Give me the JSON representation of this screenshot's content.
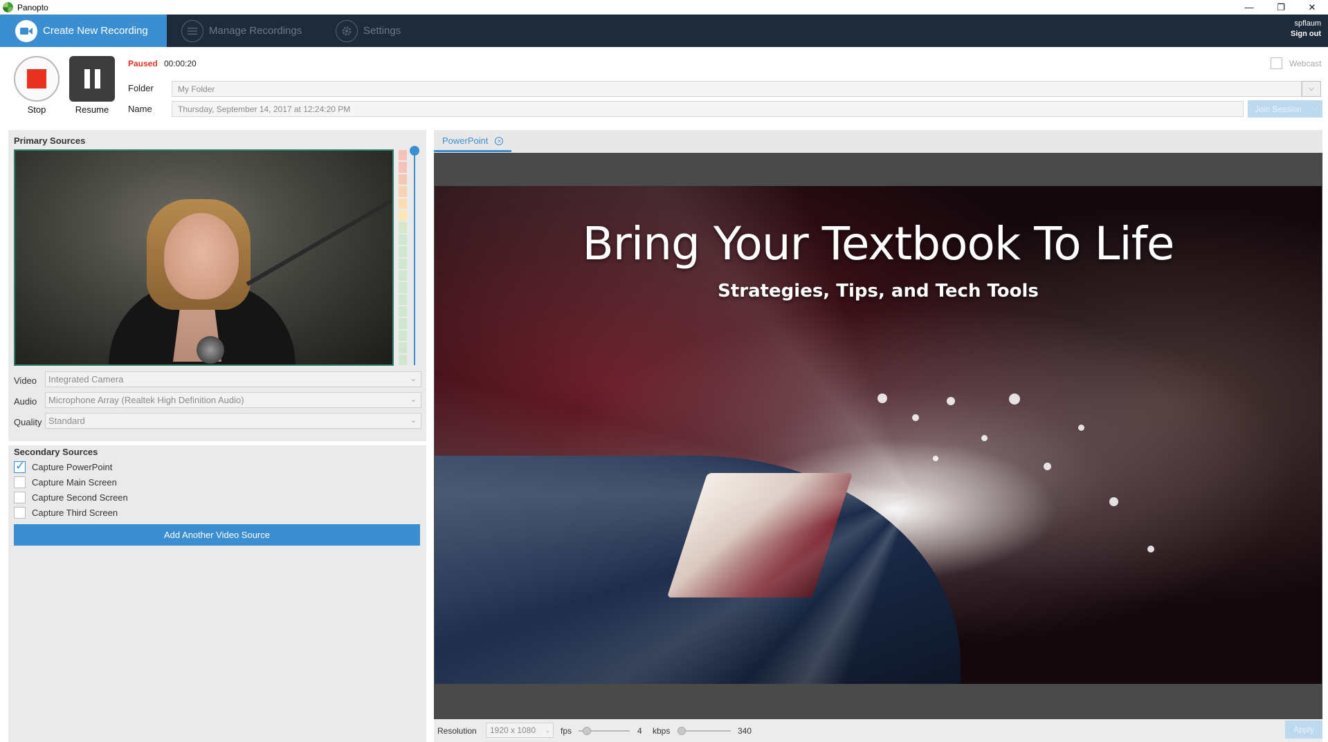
{
  "window": {
    "title": "Panopto",
    "controls": {
      "minimize": "—",
      "restore": "❐",
      "close": "✕"
    }
  },
  "nav": {
    "tabs": [
      {
        "label": "Create New Recording",
        "icon": "video-camera-icon",
        "active": true
      },
      {
        "label": "Manage Recordings",
        "icon": "list-icon",
        "active": false
      },
      {
        "label": "Settings",
        "icon": "gear-icon",
        "active": false
      }
    ],
    "user": {
      "name": "spflaum",
      "signout": "Sign out"
    },
    "colors": {
      "bar": "#1d2b3b",
      "active_tab": "#3b8fd0"
    }
  },
  "recording": {
    "stop_label": "Stop",
    "resume_label": "Resume",
    "status": "Paused",
    "elapsed": "00:00:20",
    "folder_label": "Folder",
    "folder_value": "My Folder",
    "name_label": "Name",
    "name_value": "Thursday, September 14, 2017 at 12:24:20 PM",
    "join_session": "Join Session",
    "webcast_label": "Webcast",
    "webcast_checked": false,
    "colors": {
      "stop": "#e8311f",
      "status": "#e8311f"
    }
  },
  "primary_sources": {
    "title": "Primary Sources",
    "video_label": "Video",
    "video_value": "Integrated Camera",
    "audio_label": "Audio",
    "audio_value": "Microphone Array (Realtek High Definition Audio)",
    "quality_label": "Quality",
    "quality_value": "Standard",
    "audio_level_fraction": 0.8
  },
  "secondary_sources": {
    "title": "Secondary Sources",
    "items": [
      {
        "label": "Capture PowerPoint",
        "checked": true
      },
      {
        "label": "Capture Main Screen",
        "checked": false
      },
      {
        "label": "Capture Second Screen",
        "checked": false
      },
      {
        "label": "Capture Third Screen",
        "checked": false
      }
    ],
    "add_button": "Add Another Video Source"
  },
  "preview": {
    "tab_label": "PowerPoint",
    "tab_close_icon": "circle-close-icon",
    "slide_title": "Bring Your Textbook To Life",
    "slide_subtitle": "Strategies, Tips, and Tech Tools"
  },
  "output_settings": {
    "resolution_label": "Resolution",
    "resolution_value": "1920 x 1080",
    "fps_label": "fps",
    "fps_value": "4",
    "kbps_label": "kbps",
    "kbps_value": "340",
    "apply": "Apply"
  }
}
